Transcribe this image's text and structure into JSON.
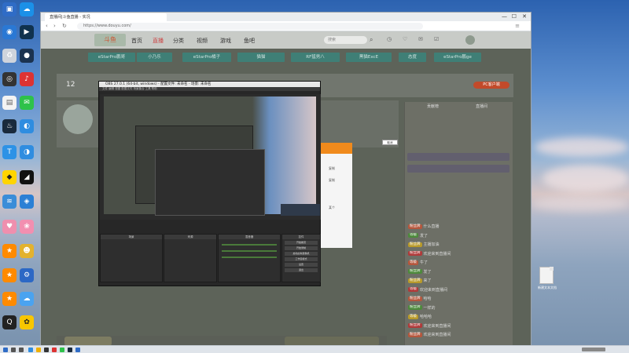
{
  "browser": {
    "tab_title": "直播间|斗鱼直播 - 实况",
    "url": "https://www.douyu.com/",
    "win_minimize": "—",
    "win_maximize": "☐",
    "win_close": "✕"
  },
  "site": {
    "nav": [
      "首页",
      "直播",
      "分类",
      "视频",
      "游戏",
      "鱼吧"
    ],
    "search_placeholder": "搜索",
    "chips": [
      "eStarPro鹏哥",
      "小乃乐",
      "eStarPro橘子",
      "猫猫",
      "RF猛男八",
      "黑猫ExcE",
      "态度",
      "eStarPro鹏ge"
    ],
    "room_number": "12",
    "pc_button": "PC客户端",
    "danmu_header": "直播间",
    "rank_tab": "贡献榜",
    "chat_lines": [
      {
        "badge": "粉丝牌",
        "text": "什么直播"
      },
      {
        "badge": "等级",
        "text": "发了"
      },
      {
        "badge": "粉丝牌",
        "text": "主播加油"
      },
      {
        "badge": "粉丝牌",
        "text": "欢迎来到直播间"
      },
      {
        "badge": "等级",
        "text": "牛了"
      },
      {
        "badge": "粉丝牌",
        "text": "发了"
      },
      {
        "badge": "粉丝牌",
        "text": "来了"
      },
      {
        "badge": "等级",
        "text": "欢迎来到直播间"
      },
      {
        "badge": "粉丝牌",
        "text": "哈哈"
      },
      {
        "badge": "粉丝牌",
        "text": "一样的"
      },
      {
        "badge": "等级",
        "text": "哈哈哈"
      },
      {
        "badge": "粉丝牌",
        "text": "欢迎来到直播间"
      },
      {
        "badge": "粉丝牌",
        "text": "欢迎来到直播间"
      }
    ],
    "send_button": "发送"
  },
  "obs": {
    "title": "OBS 27.0.1 (64-bit, windows) - 配置文件: 未命名 - 场景: 未命名",
    "menu": "文件  编辑  视图  配置文件  场景集合  工具  帮助",
    "docks": [
      "场景",
      "来源",
      "混音器",
      "转场动画",
      "控件"
    ],
    "controls": [
      "开始推流",
      "开始录制",
      "启动虚拟摄像机",
      "工作室模式",
      "设置",
      "退出"
    ]
  },
  "popup": {
    "lines": [
      "复制",
      "复制",
      "某个"
    ]
  },
  "desktop_file_label": "新建文本文档",
  "tooltip": "取消"
}
